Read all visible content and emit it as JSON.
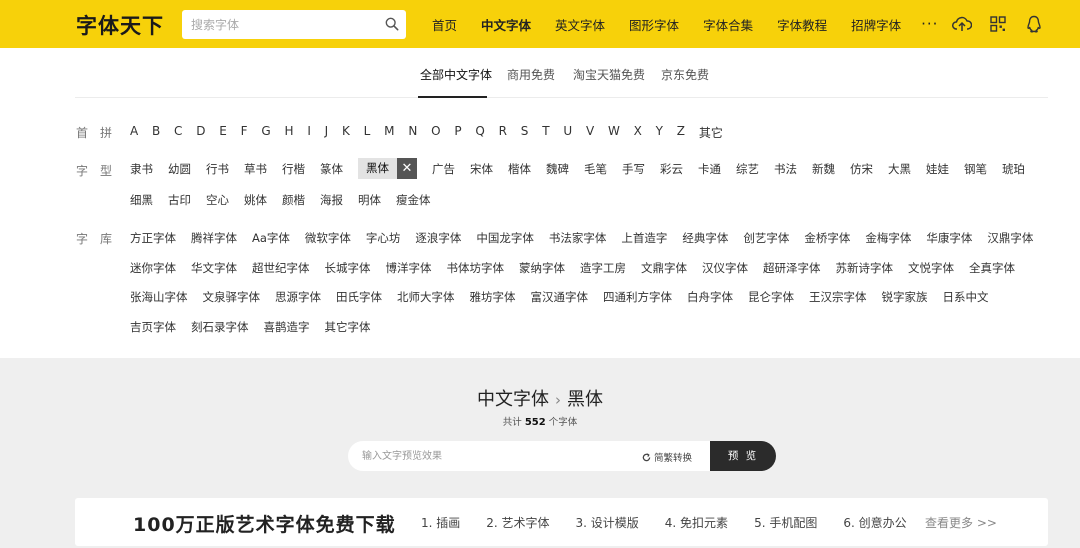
{
  "header": {
    "logo": "字体天下",
    "search_placeholder": "搜索字体",
    "nav": [
      "首页",
      "中文字体",
      "英文字体",
      "图形字体",
      "字体合集",
      "字体教程",
      "招牌字体"
    ],
    "nav_active_index": 1,
    "more": "···",
    "colors": {
      "bar": "#f7d10a",
      "text": "#222222"
    }
  },
  "subtabs": [
    "全部中文字体",
    "商用免费",
    "淘宝天猫免费",
    "京东免费"
  ],
  "filters": {
    "initial_label": "首拼",
    "letters": [
      "A",
      "B",
      "C",
      "D",
      "E",
      "F",
      "G",
      "H",
      "I",
      "J",
      "K",
      "L",
      "M",
      "N",
      "O",
      "P",
      "Q",
      "R",
      "S",
      "T",
      "U",
      "V",
      "W",
      "X",
      "Y",
      "Z",
      "其它"
    ],
    "style_label": "字型",
    "styles_row1": [
      "隶书",
      "幼圆",
      "行书",
      "草书",
      "行楷",
      "篆体"
    ],
    "style_selected": "黑体",
    "styles_row1b": [
      "广告",
      "宋体",
      "楷体",
      "魏碑",
      "毛笔",
      "手写",
      "彩云",
      "卡通",
      "综艺",
      "书法",
      "新魏",
      "仿宋",
      "大黑",
      "娃娃",
      "钢笔",
      "琥珀"
    ],
    "styles_row2": [
      "细黑",
      "古印",
      "空心",
      "姚体",
      "颜楷",
      "海报",
      "明体",
      "瘦金体"
    ],
    "library_label": "字库",
    "libraries": [
      [
        "方正字体",
        "腾祥字体",
        "Aa字体",
        "微软字体",
        "字心坊",
        "逐浪字体",
        "中国龙字体",
        "书法家字体",
        "上首造字",
        "经典字体",
        "创艺字体",
        "金桥字体",
        "金梅字体",
        "华康字体",
        "汉鼎字体"
      ],
      [
        "迷你字体",
        "华文字体",
        "超世纪字体",
        "长城字体",
        "博洋字体",
        "书体坊字体",
        "蒙纳字体",
        "造字工房",
        "文鼎字体",
        "汉仪字体",
        "超研泽字体",
        "苏新诗字体",
        "文悦字体",
        "全真字体"
      ],
      [
        "张海山字体",
        "文泉驿字体",
        "思源字体",
        "田氏字体",
        "北师大字体",
        "雅坊字体",
        "富汉通字体",
        "四通利方字体",
        "白舟字体",
        "昆仑字体",
        "王汉宗字体",
        "锐字家族",
        "日系中文"
      ],
      [
        "吉页字体",
        "刻石录字体",
        "喜鹊造字",
        "其它字体"
      ]
    ]
  },
  "breadcrumb": {
    "part1": "中文字体",
    "sep": "›",
    "part2": "黑体"
  },
  "count": {
    "prefix": "共计",
    "value": "552",
    "suffix": "个字体"
  },
  "preview": {
    "placeholder": "输入文字预览效果",
    "convert_label": "简繁转换",
    "button": "预 览"
  },
  "banner": {
    "title": "100万正版艺术字体免费下载",
    "links": [
      "1. 插画",
      "2. 艺术字体",
      "3. 设计模版",
      "4. 免扣元素",
      "5. 手机配图",
      "6. 创意办公"
    ],
    "more": "查看更多 >>"
  }
}
